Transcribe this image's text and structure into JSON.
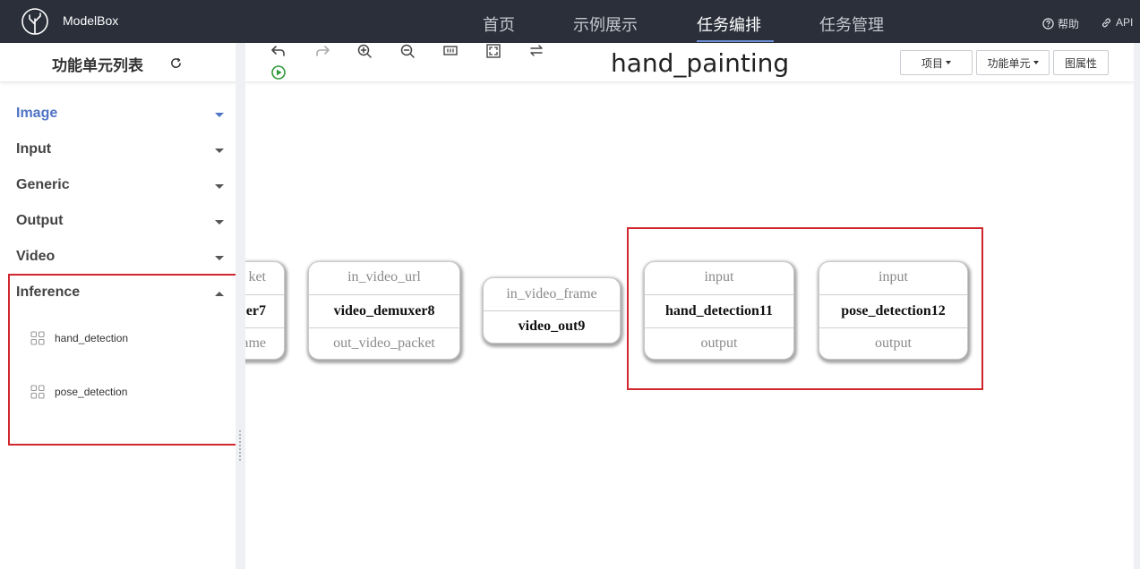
{
  "app": {
    "brand": "ModelBox",
    "nav": [
      "首页",
      "示例展示",
      "任务编排",
      "任务管理"
    ],
    "active_nav": "任务编排",
    "help_label": "帮助",
    "api_label": "API"
  },
  "sidebar": {
    "title": "功能单元列表",
    "categories": [
      {
        "label": "Image",
        "expanded": false,
        "highlight": true
      },
      {
        "label": "Input",
        "expanded": false
      },
      {
        "label": "Generic",
        "expanded": false
      },
      {
        "label": "Output",
        "expanded": false
      },
      {
        "label": "Video",
        "expanded": false
      },
      {
        "label": "Inference",
        "expanded": true
      }
    ],
    "inference_items": [
      "hand_detection",
      "pose_detection"
    ]
  },
  "toolbar": {
    "graph_title": "hand_painting",
    "project_menu": "项目",
    "unit_menu": "功能单元",
    "graph_props": "图属性"
  },
  "graph": {
    "nodes": [
      {
        "id": "partial",
        "input": "ket",
        "name": "er7",
        "output": "ame"
      },
      {
        "id": "video_demuxer8",
        "input": "in_video_url",
        "name": "video_demuxer8",
        "output": "out_video_packet"
      },
      {
        "id": "video_out9",
        "input": "in_video_frame",
        "name": "video_out9",
        "output": ""
      },
      {
        "id": "hand_detection11",
        "input": "input",
        "name": "hand_detection11",
        "output": "output"
      },
      {
        "id": "pose_detection12",
        "input": "input",
        "name": "pose_detection12",
        "output": "output"
      }
    ]
  },
  "colors": {
    "topbar": "#2b2f3a",
    "accent": "#4f74c6",
    "highlight_box": "#d0272e",
    "run_green": "#2f9a3a"
  }
}
